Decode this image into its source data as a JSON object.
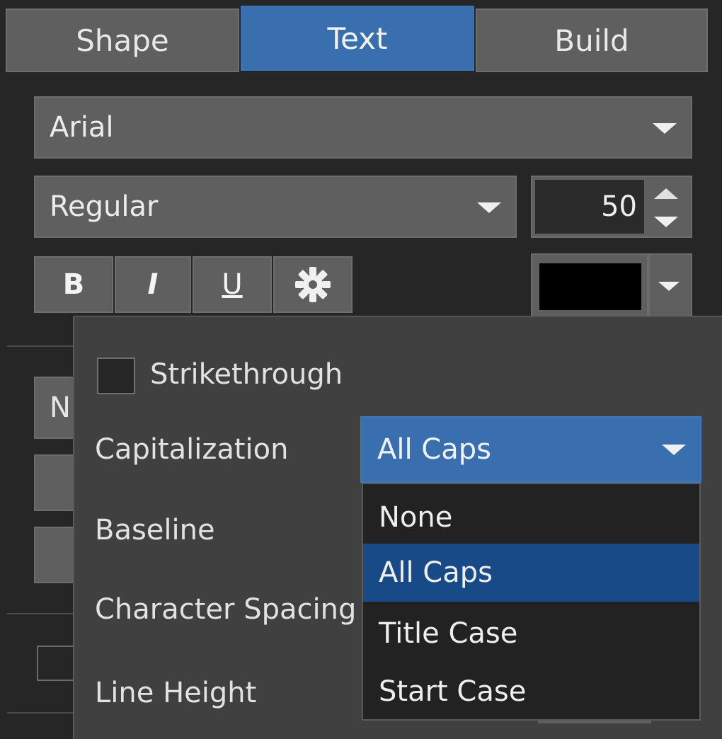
{
  "tabs": [
    {
      "label": "Shape"
    },
    {
      "label": "Text"
    },
    {
      "label": "Build"
    }
  ],
  "font": {
    "family": "Arial",
    "style": "Regular",
    "size": "50"
  },
  "format_buttons": {
    "bold": "B",
    "italic": "I",
    "underline": "U"
  },
  "color_swatch": "#000000",
  "peeking_text": "N",
  "popup": {
    "strikethrough_label": "Strikethrough",
    "strikethrough_checked": false,
    "capitalization_label": "Capitalization",
    "capitalization_value": "All Caps",
    "baseline_label": "Baseline",
    "character_spacing_label": "Character Spacing",
    "line_height_label": "Line Height",
    "options": [
      "None",
      "All Caps",
      "Title Case",
      "Start Case"
    ],
    "selected_option": "All Caps"
  },
  "colors": {
    "accent": "#3a6faf",
    "selected_option": "#174a86"
  }
}
